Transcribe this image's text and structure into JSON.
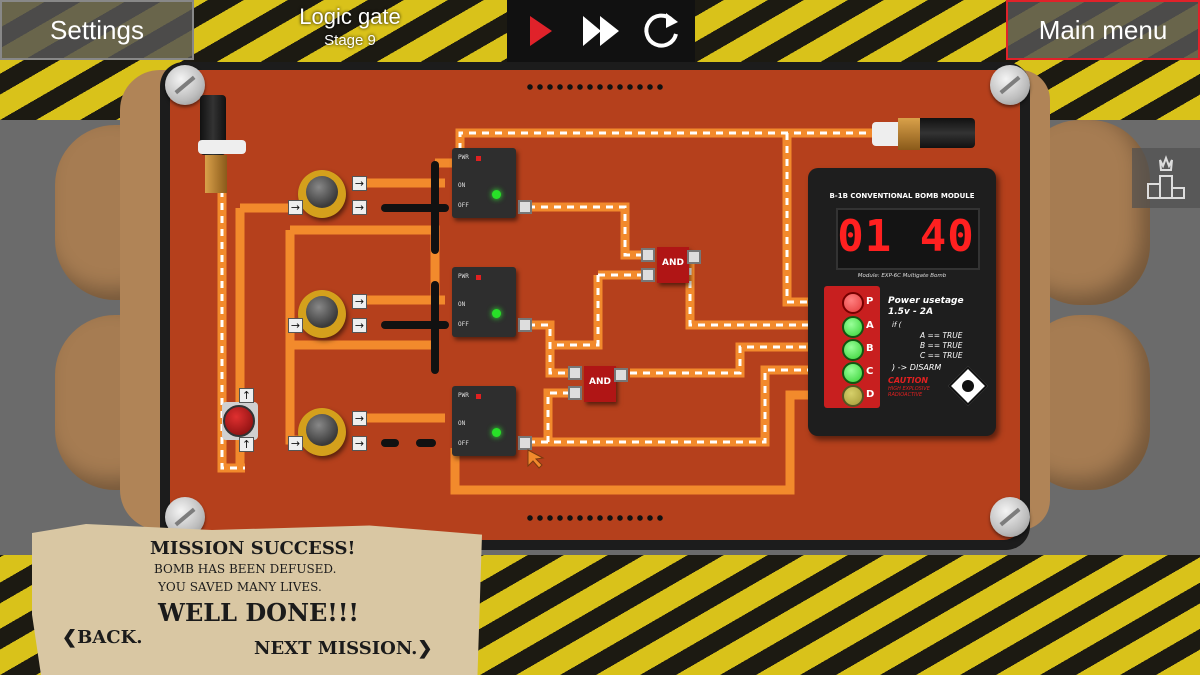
{
  "top_bar": {
    "settings_label": "Settings",
    "level_title": "Logic gate",
    "stage_label": "Stage 9",
    "main_menu_label": "Main menu",
    "play_icon": "play-icon",
    "fast_forward_icon": "fast-forward-icon",
    "restart_icon": "restart-icon"
  },
  "leaderboard_icon": "podium-icon",
  "chips": [
    {
      "pwr": "PWR",
      "on": "ON",
      "off": "OFF"
    },
    {
      "pwr": "PWR",
      "on": "ON",
      "off": "OFF"
    },
    {
      "pwr": "PWR",
      "on": "ON",
      "off": "OFF"
    }
  ],
  "gates": [
    {
      "label": "AND"
    },
    {
      "label": "AND"
    }
  ],
  "bomb_module": {
    "header": "B-1B CONVENTIONAL BOMB MODULE",
    "timer": "01 40",
    "subtitle": "Module: EXP-6C Multigate Bomb",
    "led_labels": [
      "P",
      "A",
      "B",
      "C",
      "D"
    ],
    "power_usage_title": "Power usetage",
    "power_usage_value": "1.5v - 2A",
    "if_label": "if (",
    "cond_a": "A == TRUE",
    "cond_b": "B == TRUE",
    "cond_c": "C == TRUE",
    "result": ") -> DISARM",
    "caution": "CAUTION",
    "caution_note": "HIGH EXPLOSIVE RADIOACTIVE",
    "hazard_icon": "skull-hazard-icon",
    "colors": {
      "led_off": "#a49a36",
      "led_on": "#35d135",
      "led_red": "#e43a3a",
      "timer": "#ff2020"
    }
  },
  "mission_note": {
    "title": "MISSION SUCCESS!",
    "line1": "BOMB HAS BEEN DEFUSED.",
    "line2": "YOU SAVED MANY LIVES.",
    "well_done": "WELL DONE!!!",
    "back_label": "BACK.",
    "next_label": "NEXT MISSION."
  },
  "colors": {
    "board": "#b5401c",
    "wire": "#f28a2c",
    "accent_red": "#e0222a",
    "hazard_yellow": "#d9c21a"
  }
}
